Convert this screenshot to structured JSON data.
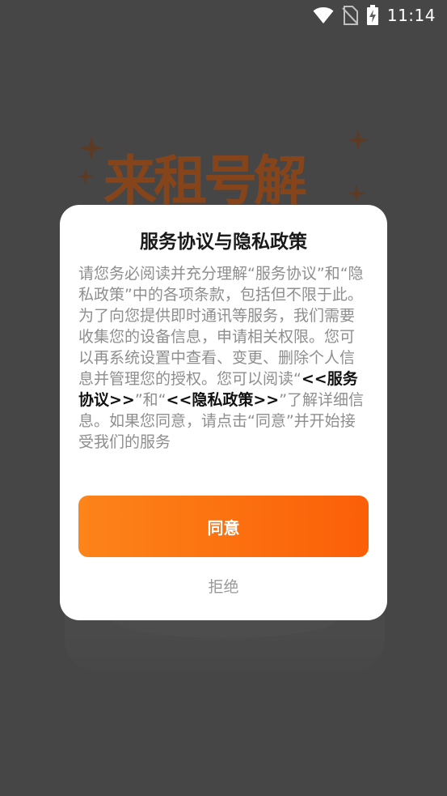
{
  "status_bar": {
    "time": "11:14",
    "icons": [
      "wifi-icon",
      "no-sim-icon",
      "battery-charging-icon"
    ]
  },
  "background": {
    "splash_title": "来租号解"
  },
  "dialog": {
    "title": "服务协议与隐私政策",
    "body": {
      "text_1": "请您务必阅读并充分理解“服务协议”和“隐私政策”中的各项条款，包括但不限于此。为了向您提供即时通讯等服务，我们需要收集您的设备信息，申请相关权限。您可以再系统设置中查看、变更、删除个人信息并管理您的授权。您可以阅读“",
      "link_service": "<<服务协议>>",
      "text_2": "”和“",
      "link_privacy": "<<隐私政策>>",
      "text_3": "”了解详细信息。如果您同意，请点击“同意”并开始接受我们的服务"
    },
    "agree_label": "同意",
    "reject_label": "拒绝"
  },
  "colors": {
    "accent_start": "#fc8419",
    "accent_end": "#fb5f08",
    "dim_background": "#5f5f5f"
  }
}
